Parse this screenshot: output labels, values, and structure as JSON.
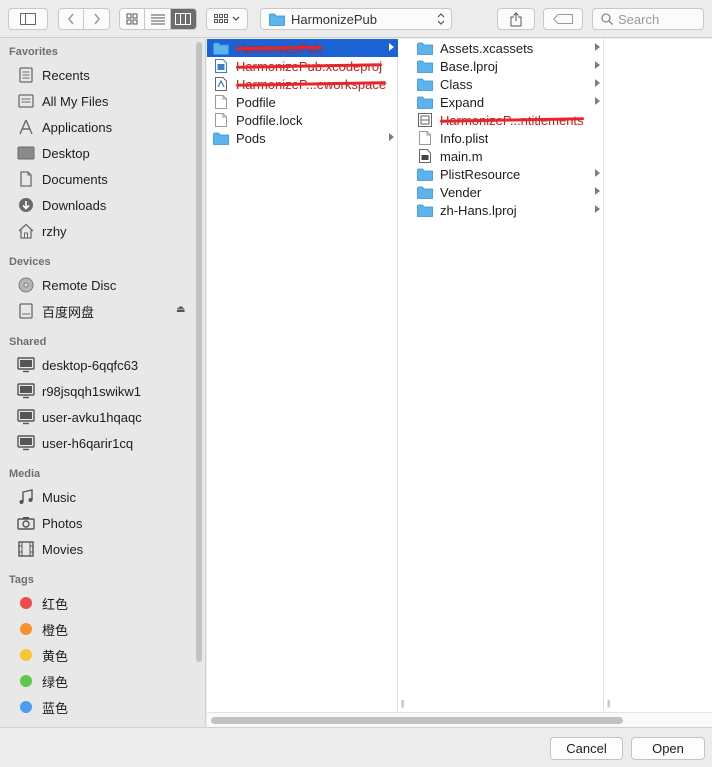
{
  "toolbar": {
    "location": "HarmonizePub",
    "search_placeholder": "Search"
  },
  "sidebar": {
    "sections": {
      "favorites": "Favorites",
      "devices": "Devices",
      "shared": "Shared",
      "media": "Media",
      "tags": "Tags"
    },
    "favorites": [
      {
        "label": "Recents",
        "icon": "recents-icon"
      },
      {
        "label": "All My Files",
        "icon": "all-files-icon"
      },
      {
        "label": "Applications",
        "icon": "applications-icon"
      },
      {
        "label": "Desktop",
        "icon": "desktop-icon"
      },
      {
        "label": "Documents",
        "icon": "documents-icon"
      },
      {
        "label": "Downloads",
        "icon": "downloads-icon"
      },
      {
        "label": "rzhy",
        "icon": "home-icon"
      }
    ],
    "devices": [
      {
        "label": "Remote Disc",
        "icon": "disc-icon"
      },
      {
        "label": "百度网盘",
        "icon": "drive-icon"
      }
    ],
    "shared": [
      {
        "label": "desktop-6qqfc63",
        "icon": "computer-icon"
      },
      {
        "label": "r98jsqqh1swikw1",
        "icon": "computer-icon"
      },
      {
        "label": "user-avku1hqaqc",
        "icon": "computer-icon"
      },
      {
        "label": "user-h6qarir1cq",
        "icon": "computer-icon"
      }
    ],
    "media": [
      {
        "label": "Music",
        "icon": "music-icon"
      },
      {
        "label": "Photos",
        "icon": "photos-icon"
      },
      {
        "label": "Movies",
        "icon": "movies-icon"
      }
    ],
    "tags": [
      {
        "label": "红色",
        "color": "#f04a4a"
      },
      {
        "label": "橙色",
        "color": "#f5922f"
      },
      {
        "label": "黄色",
        "color": "#f6c631"
      },
      {
        "label": "绿色",
        "color": "#5fc84a"
      },
      {
        "label": "蓝色",
        "color": "#4a9df0"
      }
    ]
  },
  "column1": [
    {
      "label": "HarmonizePub",
      "type": "folder",
      "selected": true,
      "redacted": true
    },
    {
      "label": "HarmonizePub.xcodeproj",
      "type": "xcodeproj",
      "redacted": true
    },
    {
      "label": "HarmonizeP...eworkspace",
      "type": "workspace",
      "redacted": true
    },
    {
      "label": "Podfile",
      "type": "file"
    },
    {
      "label": "Podfile.lock",
      "type": "file"
    },
    {
      "label": "Pods",
      "type": "folder"
    }
  ],
  "column2": [
    {
      "label": "Assets.xcassets",
      "type": "folder"
    },
    {
      "label": "Base.lproj",
      "type": "folder"
    },
    {
      "label": "Class",
      "type": "folder"
    },
    {
      "label": "Expand",
      "type": "folder"
    },
    {
      "label": "HarmonizeP...ntitlements",
      "type": "entitlements",
      "redacted": true
    },
    {
      "label": "Info.plist",
      "type": "file"
    },
    {
      "label": "main.m",
      "type": "mfile"
    },
    {
      "label": "PlistResource",
      "type": "folder"
    },
    {
      "label": "Vender",
      "type": "folder"
    },
    {
      "label": "zh-Hans.lproj",
      "type": "folder"
    }
  ],
  "buttons": {
    "cancel": "Cancel",
    "open": "Open"
  },
  "colors": {
    "selection": "#1b62d5",
    "folder": "#5cb4ef",
    "redaction": "#e8262a"
  }
}
